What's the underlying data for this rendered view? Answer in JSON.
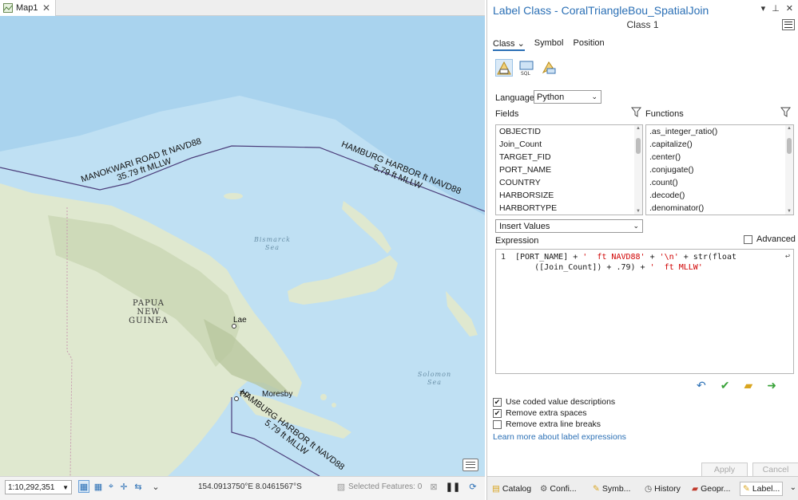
{
  "map": {
    "tab_title": "Map1",
    "labels": {
      "manokwari_line1": "MANOKWARI ROAD ft NAVD88",
      "manokwari_line2": "35.79 ft MLLW",
      "hamburg_ne_line1": "HAMBURG HARBOR ft NAVD88",
      "hamburg_ne_line2": "5.79 ft MLLW",
      "hamburg_s_line1": "HAMBURG HARBOR ft NAVD88",
      "hamburg_s_line2": "5.79 ft MLLW"
    },
    "places": {
      "country_line1": "PAPUA",
      "country_line2": "NEW",
      "country_line3": "GUINEA",
      "lae": "Lae",
      "port_moresby_part1": "Po",
      "port_moresby_part2": "Moresby"
    },
    "seas": {
      "bismarck_line1": "Bismarck",
      "bismarck_line2": "Sea",
      "solomon_line1": "Solomon",
      "solomon_line2": "Sea"
    },
    "statusbar": {
      "scale": "1:10,292,351",
      "coordinates": "154.0913750°E 8.0461567°S",
      "selected_features": "Selected Features: 0"
    }
  },
  "panel": {
    "title": "Label Class - CoralTriangleBou_SpatialJoin",
    "subtitle": "Class 1",
    "ctrl_dropdown": "▾",
    "ctrl_pin": "⊥",
    "ctrl_close": "✕",
    "tabs": {
      "class": "Class",
      "symbol": "Symbol",
      "position": "Position"
    },
    "language_label": "Language",
    "language_value": "Python",
    "fields_label": "Fields",
    "functions_label": "Functions",
    "fields": [
      "OBJECTID",
      "Join_Count",
      "TARGET_FID",
      "PORT_NAME",
      "COUNTRY",
      "HARBORSIZE",
      "HARBORTYPE"
    ],
    "functions": [
      ".as_integer_ratio()",
      ".capitalize()",
      ".center()",
      ".conjugate()",
      ".count()",
      ".decode()",
      ".denominator()"
    ],
    "insert_values": "Insert Values",
    "expression_label": "Expression",
    "advanced_label": "Advanced",
    "line_number": "1",
    "expr": {
      "l1a": "[PORT_NAME] + ",
      "l1b": "'  ft NAVD88'",
      "l1c": " + ",
      "l1d": "'\\n'",
      "l1e": " + str(float",
      "l2a": "([Join_Count]) + .79) + ",
      "l2b": "'  ft MLLW'"
    },
    "options": [
      {
        "label": "Use coded value descriptions",
        "checked": true
      },
      {
        "label": "Remove extra spaces",
        "checked": true
      },
      {
        "label": "Remove extra line breaks",
        "checked": false
      }
    ],
    "learn_link": "Learn more about label expressions",
    "apply": "Apply",
    "cancel": "Cancel"
  },
  "bottom_tabs": [
    "Catalog",
    "Confi...",
    "Symb...",
    "History",
    "Geopr...",
    "Label..."
  ],
  "colors": {
    "accent": "#2a6fb5",
    "water": "#bfe0f3",
    "land": "#dfe8cf",
    "boundary": "#4b3d7a",
    "string": "#d00000"
  }
}
